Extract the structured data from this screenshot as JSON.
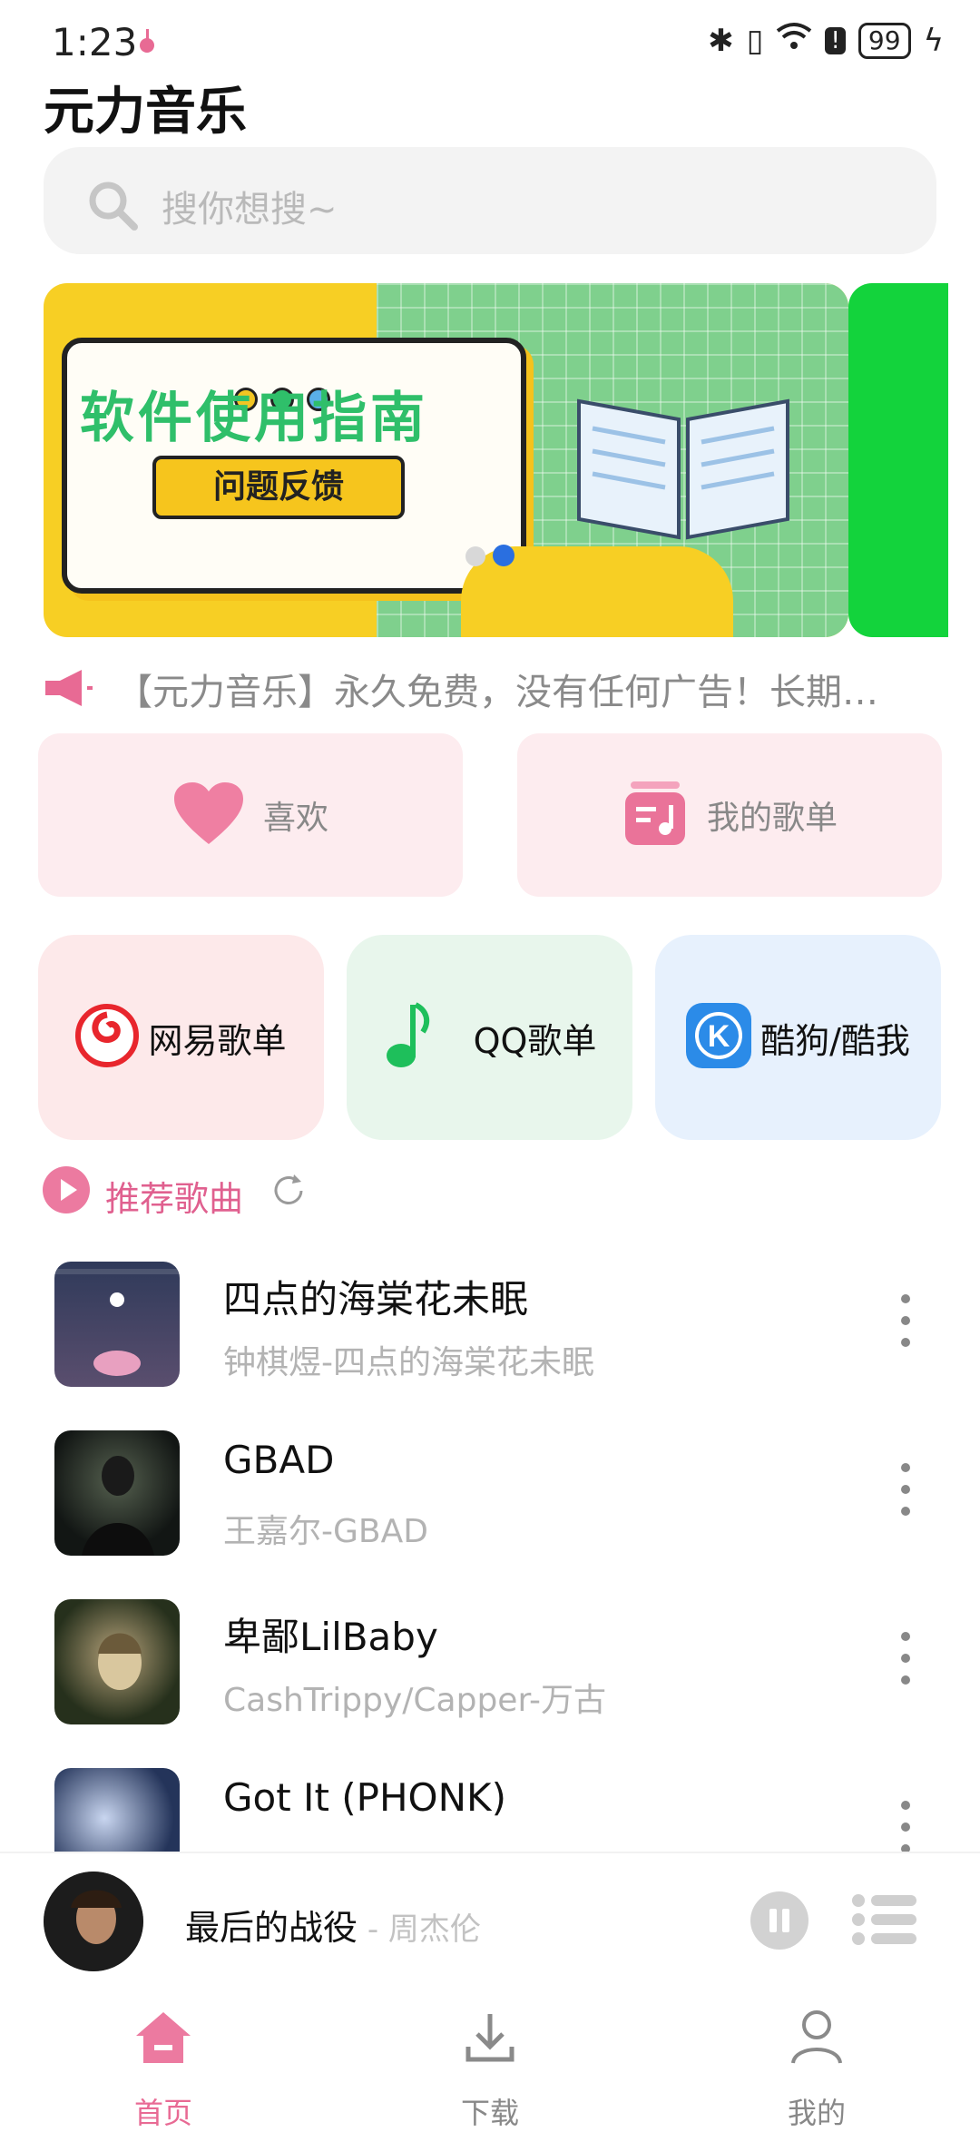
{
  "status_bar": {
    "time": "1:23",
    "battery": "99"
  },
  "app": {
    "title": "元力音乐"
  },
  "search": {
    "placeholder": "搜你想搜~"
  },
  "banner": {
    "main_text": "软件使用指南",
    "sub_text": "问题反馈"
  },
  "notice": {
    "text": "【元力音乐】永久免费，没有任何广告！长期…"
  },
  "quick_cards": [
    {
      "label": "喜欢",
      "icon": "heart-icon"
    },
    {
      "label": "我的歌单",
      "icon": "playlist-icon"
    }
  ],
  "sources": [
    {
      "label": "网易歌单",
      "icon": "netease-logo-icon",
      "bg": "#fde9ea"
    },
    {
      "label": "QQ歌单",
      "icon": "qq-music-icon",
      "bg": "#e8f6ec"
    },
    {
      "label": "酷狗/酷我",
      "icon": "kugou-icon",
      "bg": "#e7f1fd"
    }
  ],
  "recommend": {
    "title": "推荐歌曲"
  },
  "songs": [
    {
      "title": "四点的海棠花未眠",
      "subtitle": "钟棋煜-四点的海棠花未眠",
      "cover_color": "#3b3550"
    },
    {
      "title": "GBAD",
      "subtitle": "王嘉尔-GBAD",
      "cover_color": "#1e2522"
    },
    {
      "title": "卑鄙LilBaby",
      "subtitle": "CashTrippy/Capper-万古",
      "cover_color": "#2a3322"
    },
    {
      "title": "Got It (PHONK)",
      "subtitle": "",
      "cover_color": "#24345a"
    }
  ],
  "player": {
    "title": "最后的战役",
    "artist": "周杰伦"
  },
  "nav": [
    {
      "label": "首页",
      "active": true
    },
    {
      "label": "下载",
      "active": false
    },
    {
      "label": "我的",
      "active": false
    }
  ],
  "colors": {
    "accent": "#e86a94",
    "netease": "#e8262d",
    "qq": "#1ebf5b",
    "kugou": "#2b8be8"
  }
}
